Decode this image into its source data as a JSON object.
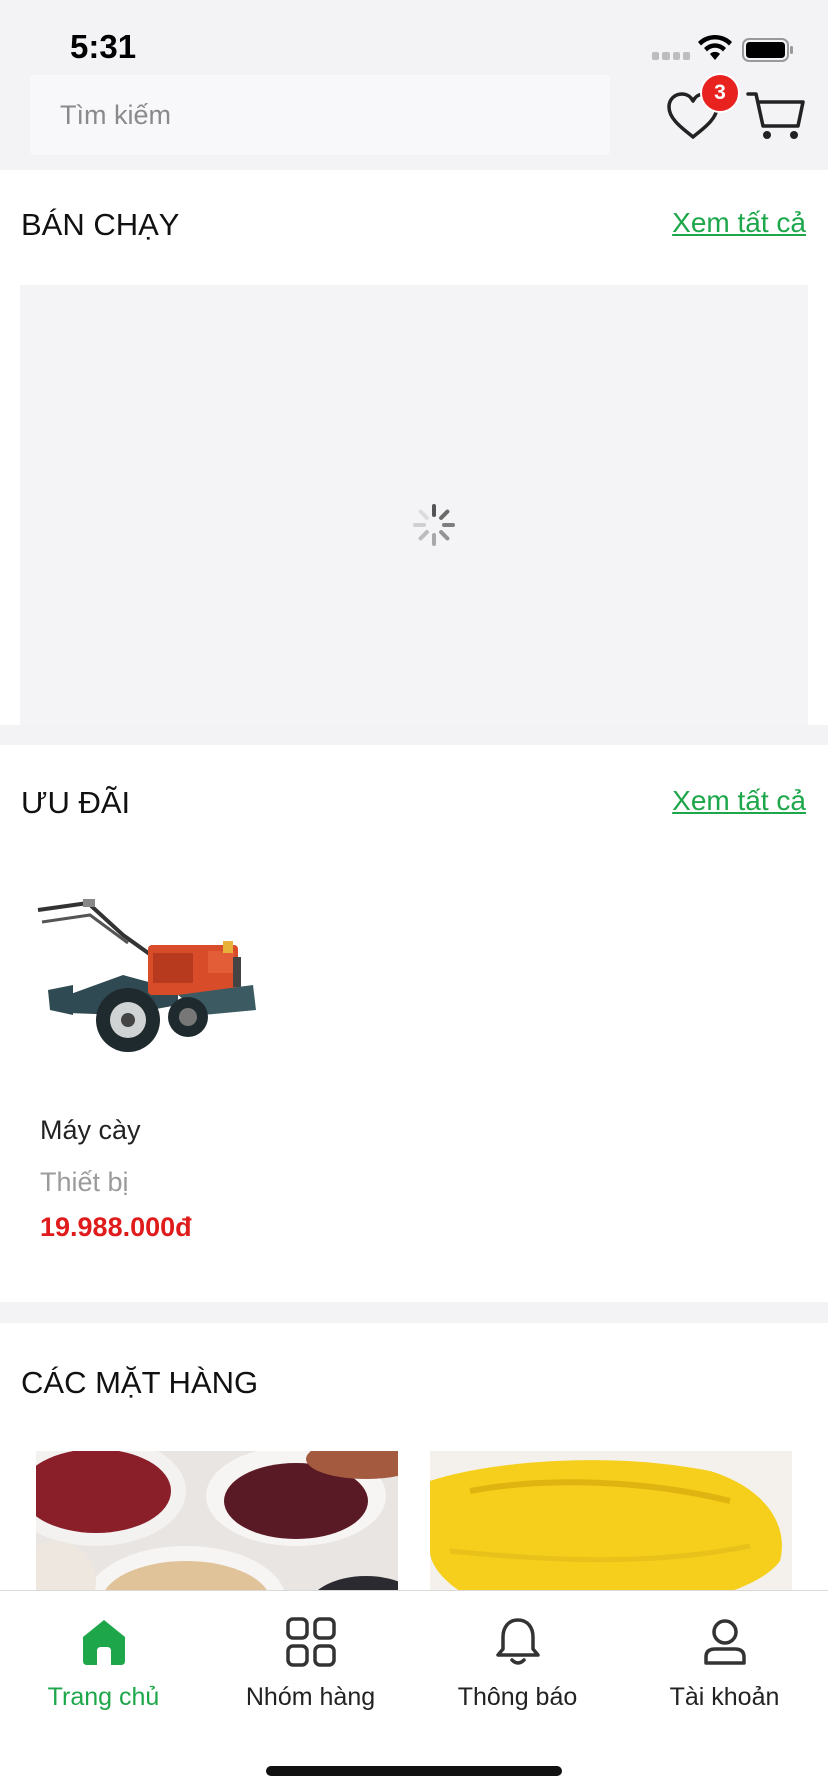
{
  "status_bar": {
    "time": "5:31"
  },
  "header": {
    "search_placeholder": "Tìm kiếm",
    "wishlist_count": "3"
  },
  "best_sellers": {
    "title": "BÁN CHẠY",
    "see_all": "Xem tất cả"
  },
  "promotions": {
    "title": "ƯU ĐÃI",
    "see_all": "Xem tất cả",
    "products": [
      {
        "name": "Máy cày",
        "category": "Thiết bị",
        "price": "19.988.000đ"
      }
    ]
  },
  "categories": {
    "title": "CÁC MẶT HÀNG"
  },
  "tabbar": {
    "items": [
      {
        "label": "Trang chủ",
        "icon": "home-icon",
        "active": true
      },
      {
        "label": "Nhóm hàng",
        "icon": "grid-icon",
        "active": false
      },
      {
        "label": "Thông báo",
        "icon": "bell-icon",
        "active": false
      },
      {
        "label": "Tài khoản",
        "icon": "user-icon",
        "active": false
      }
    ]
  },
  "colors": {
    "accent_green": "#1ea64a",
    "price_red": "#e01b1b",
    "badge_red": "#e8221f"
  }
}
